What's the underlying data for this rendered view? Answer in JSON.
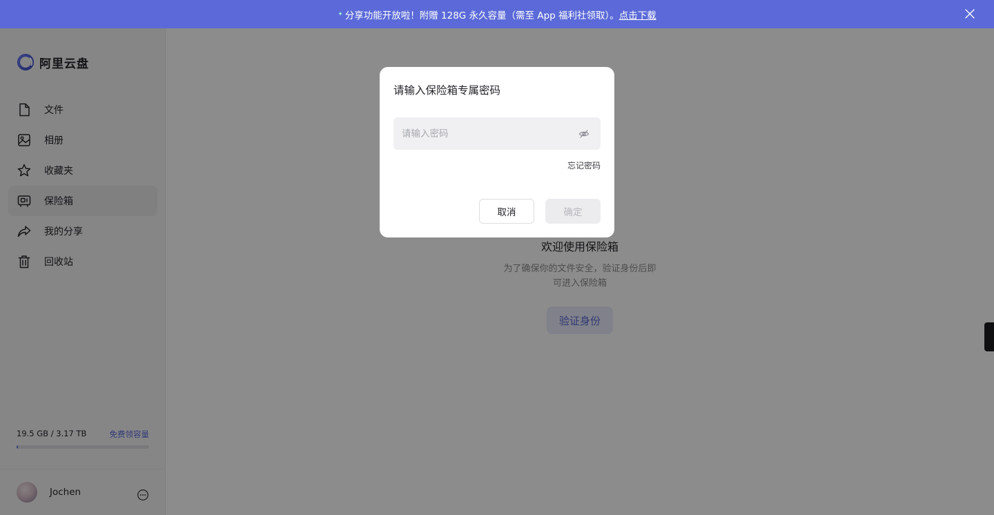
{
  "banner": {
    "text": "分享功能开放啦！附赠 128G 永久容量（需至 App 福利社领取）。",
    "link": "点击下载",
    "spark_icon": "sparkle-icon",
    "close_icon": "close-icon"
  },
  "brand": {
    "name": "阿里云盘",
    "logo_icon": "aliyundrive-logo"
  },
  "sidebar": {
    "items": [
      {
        "label": "文件",
        "icon": "file-icon",
        "active": false
      },
      {
        "label": "相册",
        "icon": "album-icon",
        "active": false
      },
      {
        "label": "收藏夹",
        "icon": "star-icon",
        "active": false
      },
      {
        "label": "保险箱",
        "icon": "safe-icon",
        "active": true
      },
      {
        "label": "我的分享",
        "icon": "share-icon",
        "active": false
      },
      {
        "label": "回收站",
        "icon": "trash-icon",
        "active": false
      }
    ],
    "storage": {
      "used_text": "19.5 GB / 3.17 TB",
      "free_link": "免费领容量",
      "used_fraction": 0.006
    },
    "user": {
      "name": "Jochen",
      "more_icon": "more-icon"
    }
  },
  "main": {
    "welcome_title": "欢迎使用保险箱",
    "welcome_desc_line1": "为了确保你的文件安全，验证身份后即",
    "welcome_desc_line2": "可进入保险箱",
    "verify_button": "验证身份"
  },
  "modal": {
    "title": "请输入保险箱专属密码",
    "password_placeholder": "请输入密码",
    "password_value": "",
    "eye_icon": "eye-off-icon",
    "forgot_link": "忘记密码",
    "cancel_button": "取消",
    "confirm_button": "确定"
  },
  "colors": {
    "accent": "#5b6ad8",
    "overlay": "rgba(0,0,0,0.45)",
    "sidebar_bg": "#f5f5f6"
  }
}
